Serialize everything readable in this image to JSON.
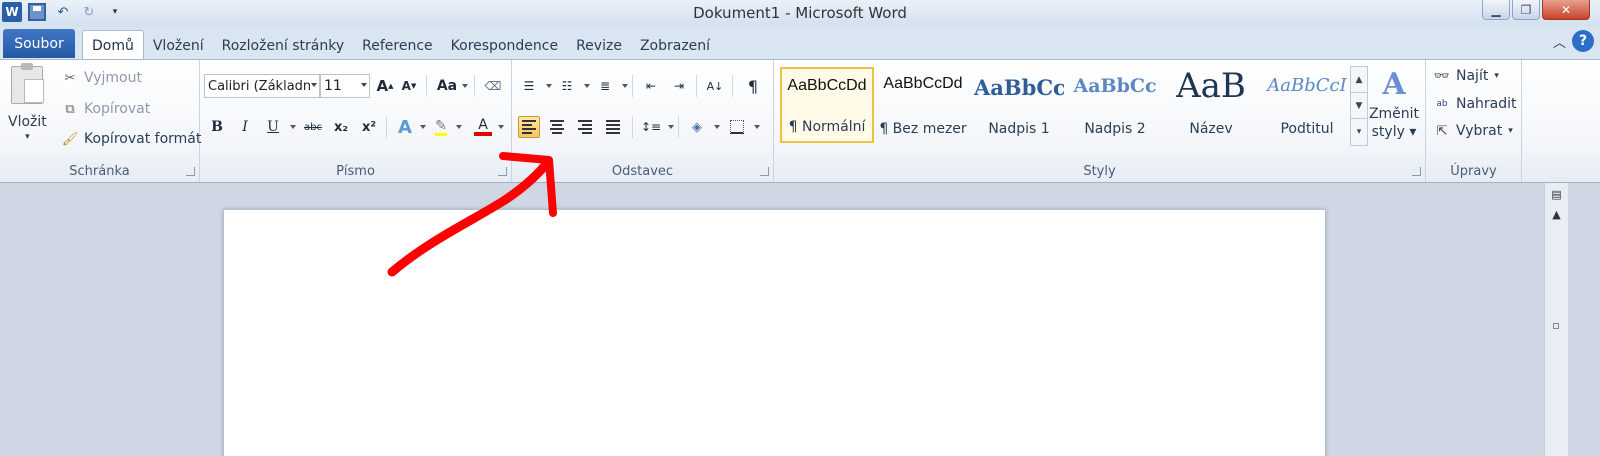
{
  "window": {
    "title": "Dokument1 - Microsoft Word"
  },
  "qat": {
    "app_icon": "word-icon",
    "undo_icon": "undo-icon",
    "redo_icon": "redo-icon"
  },
  "tabs": {
    "file": "Soubor",
    "items": [
      "Domů",
      "Vložení",
      "Rozložení stránky",
      "Reference",
      "Korespondence",
      "Revize",
      "Zobrazení"
    ],
    "active": "Domů"
  },
  "clipboard": {
    "label": "Schránka",
    "paste": "Vložit",
    "cut": "Vyjmout",
    "copy": "Kopírovat",
    "format_painter": "Kopírovat formát"
  },
  "font": {
    "label": "Písmo",
    "family": "Calibri (Základn",
    "size": "11",
    "change_case": "Aa",
    "bold": "B",
    "italic": "I",
    "underline": "U",
    "strikethrough": "abc",
    "subscript": "x₂",
    "superscript": "x²",
    "grow": "A",
    "shrink": "A",
    "text_effects": "A",
    "font_color": "A",
    "font_color_value": "#e00000"
  },
  "paragraph": {
    "label": "Odstavec",
    "pilcrow": "¶",
    "active_alignment": "left"
  },
  "styles": {
    "label": "Styly",
    "items": [
      {
        "preview": "AaBbCcDd",
        "name": "¶ Normální",
        "selected": true
      },
      {
        "preview": "AaBbCcDd",
        "name": "¶ Bez mezer",
        "selected": false
      },
      {
        "preview": "AaBbCc",
        "name": "Nadpis 1",
        "selected": false
      },
      {
        "preview": "AaBbCc",
        "name": "Nadpis 2",
        "selected": false
      },
      {
        "preview": "AaB",
        "name": "Název",
        "selected": false
      },
      {
        "preview": "AaBbCcI",
        "name": "Podtitul",
        "selected": false
      }
    ],
    "change_styles": [
      "Změnit",
      "styly"
    ]
  },
  "editing": {
    "label": "Úpravy",
    "find": "Najít",
    "replace": "Nahradit",
    "select": "Vybrat"
  },
  "annotation": {
    "color": "#ff0000"
  }
}
